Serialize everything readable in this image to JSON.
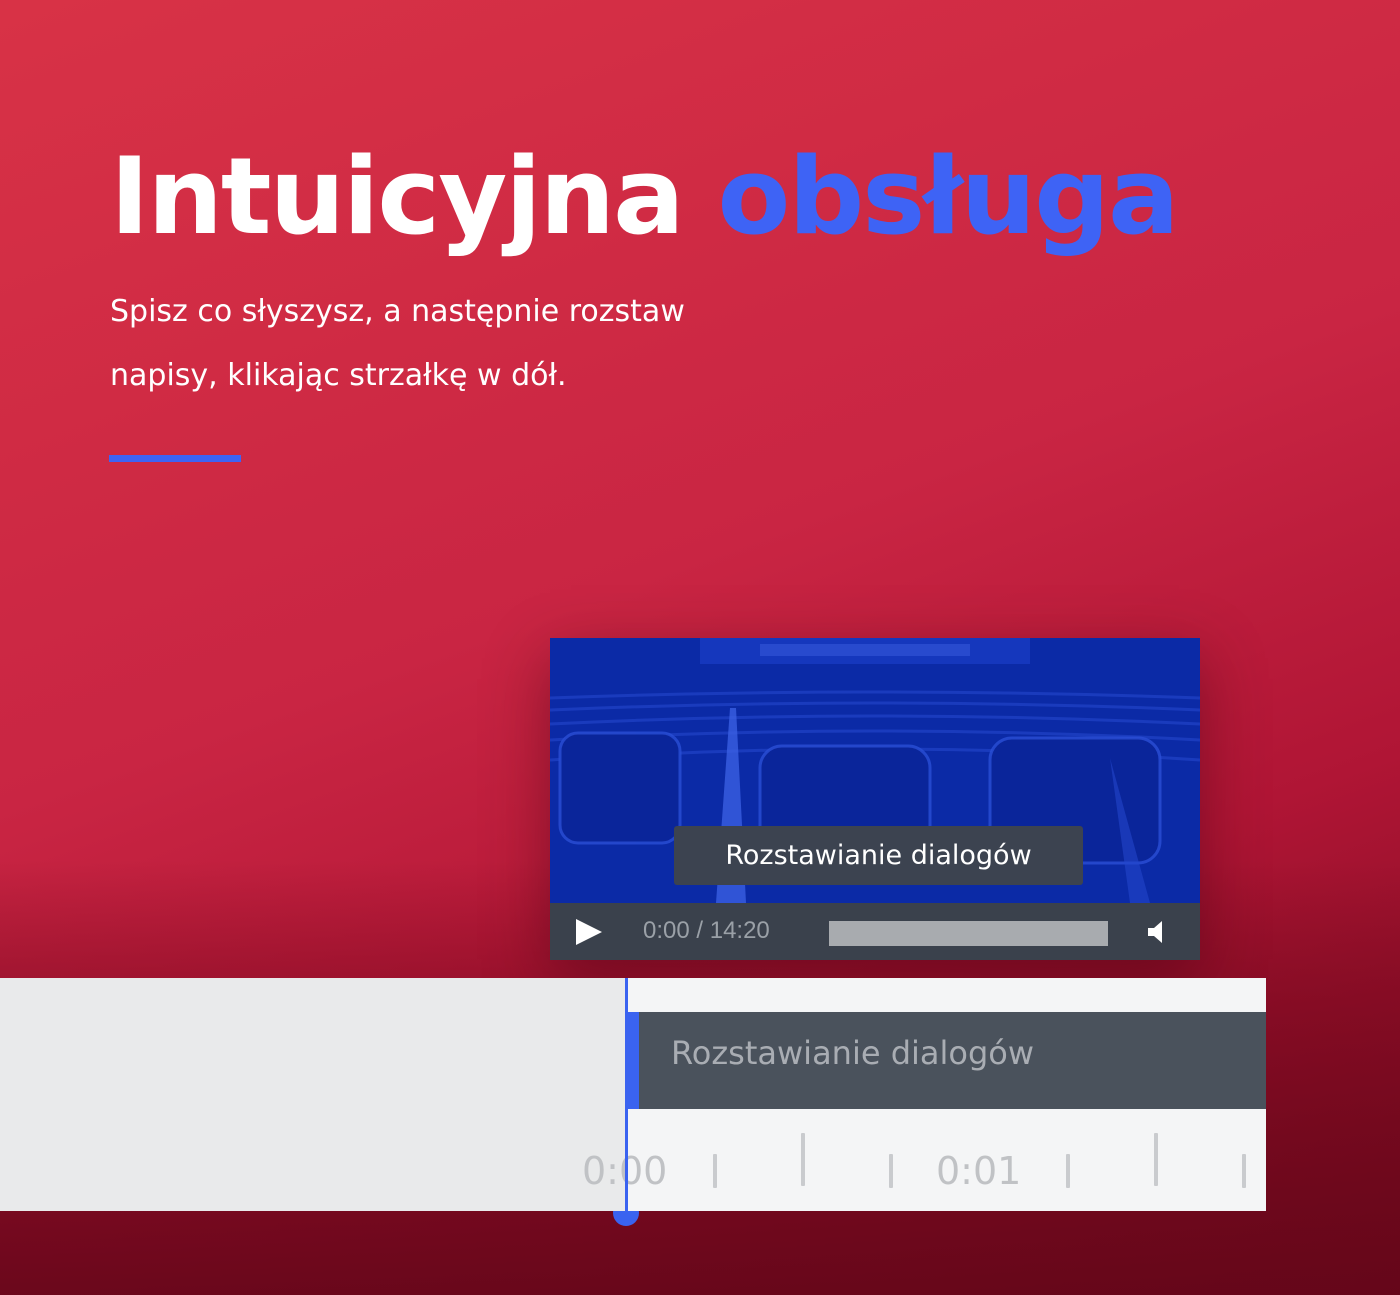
{
  "hero": {
    "title_main": "Intuicyjna",
    "title_accent": "obsługa",
    "subtitle": "Spisz co słyszysz, a następnie rozstaw napisy, klikając strzałkę w dół."
  },
  "player": {
    "subtitle_text": "Rozstawianie dialogów",
    "time": "0:00 / 14:20",
    "progress_fraction": 0,
    "play_icon": "play-icon",
    "volume_icon": "volume-icon"
  },
  "timeline": {
    "track_label": "Rozstawianie dialogów",
    "ruler_labels": [
      "0:00",
      "0:01"
    ]
  },
  "colors": {
    "background": "#c92543",
    "accent": "#3e63f5",
    "player_bg": "#0c2db0",
    "controls_bg": "#3a414c",
    "track_bg": "#4a525c"
  }
}
